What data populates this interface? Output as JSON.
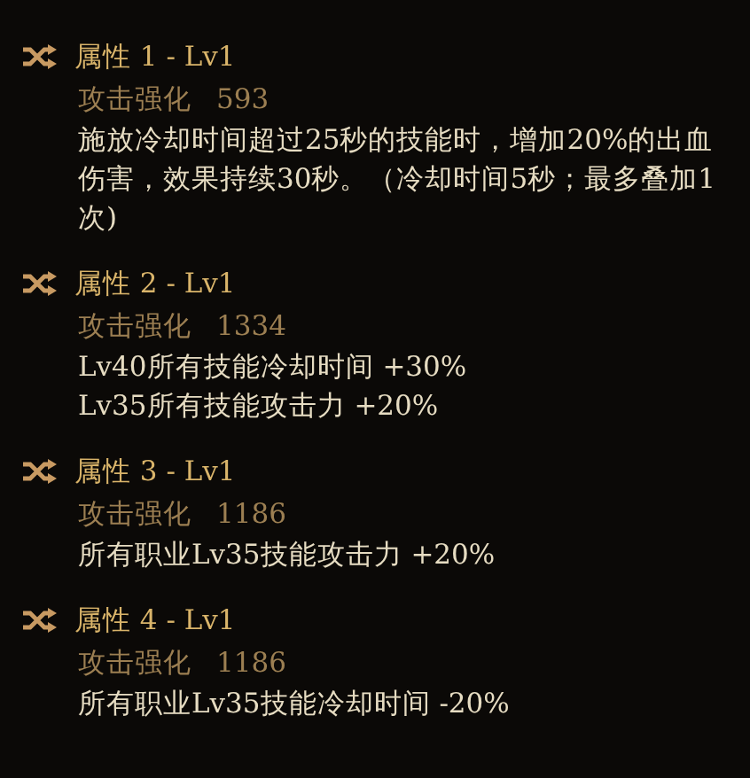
{
  "attributes": [
    {
      "title": "属性 1 - Lv1",
      "stat_label": "攻击强化",
      "stat_value": "593",
      "effects": [
        "施放冷却时间超过25秒的技能时，增加20%的出血伤害，效果持续30秒。（冷却时间5秒；最多叠加1次)"
      ]
    },
    {
      "title": "属性 2 - Lv1",
      "stat_label": "攻击强化",
      "stat_value": "1334",
      "effects": [
        "Lv40所有技能冷却时间 +30%",
        "Lv35所有技能攻击力 +20%"
      ]
    },
    {
      "title": "属性 3 - Lv1",
      "stat_label": "攻击强化",
      "stat_value": "1186",
      "effects": [
        "所有职业Lv35技能攻击力 +20%"
      ]
    },
    {
      "title": "属性 4 - Lv1",
      "stat_label": "攻击强化",
      "stat_value": "1186",
      "effects": [
        "所有职业Lv35技能冷却时间 -20%"
      ]
    }
  ]
}
